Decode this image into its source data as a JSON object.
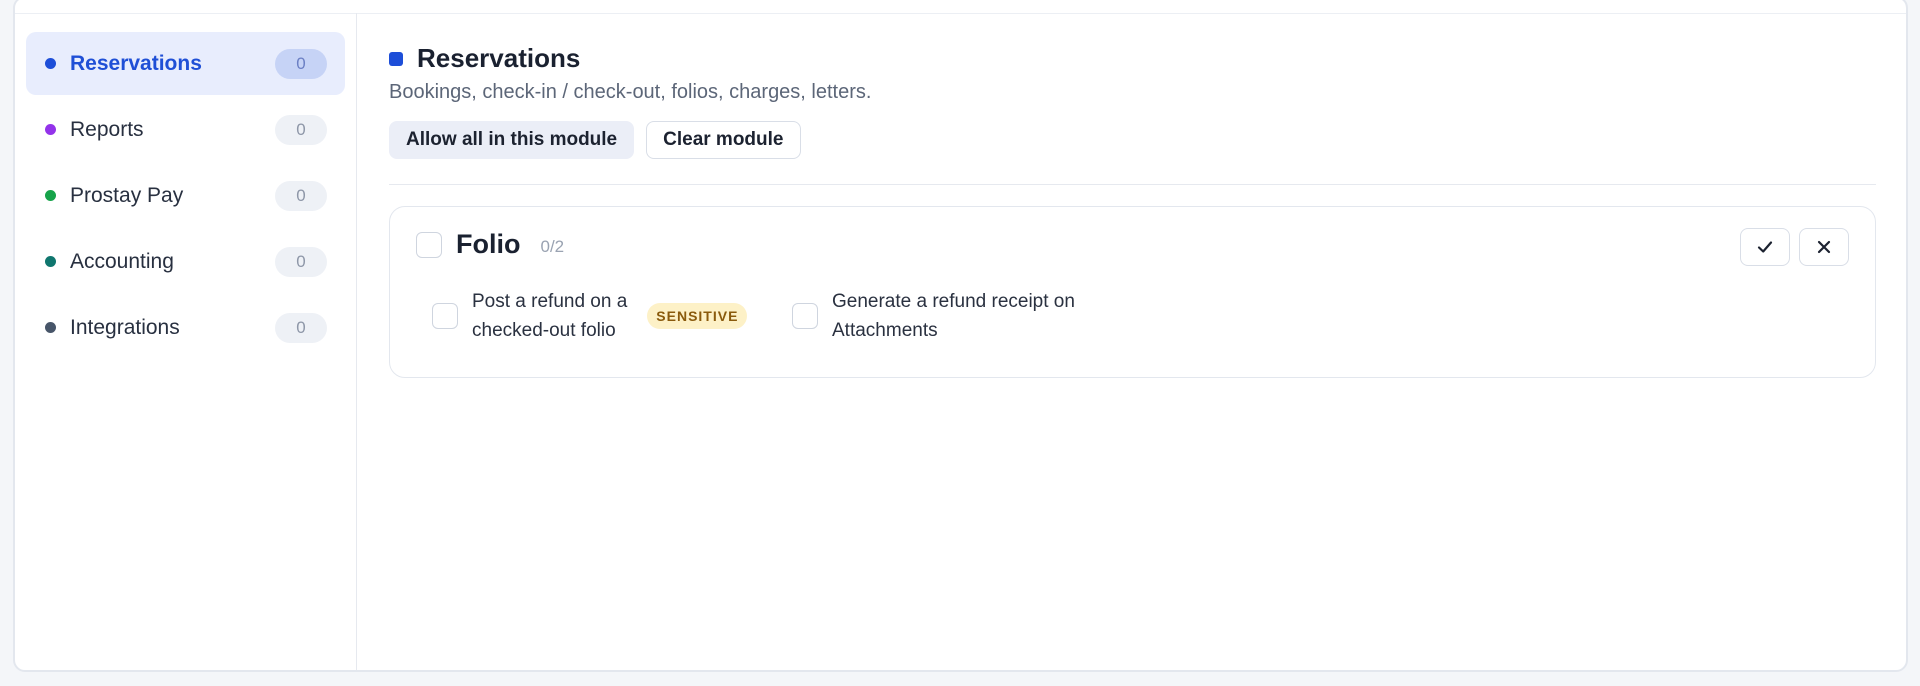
{
  "sidebar": {
    "items": [
      {
        "label": "Reservations",
        "count": "0",
        "color": "#1d4ed8",
        "active": true
      },
      {
        "label": "Reports",
        "count": "0",
        "color": "#9333ea",
        "active": false
      },
      {
        "label": "Prostay Pay",
        "count": "0",
        "color": "#16a34a",
        "active": false
      },
      {
        "label": "Accounting",
        "count": "0",
        "color": "#0f766e",
        "active": false
      },
      {
        "label": "Integrations",
        "count": "0",
        "color": "#475569",
        "active": false
      }
    ]
  },
  "module": {
    "title": "Reservations",
    "description": "Bookings, check-in / check-out, folios, charges, letters.",
    "color": "#1d4ed8",
    "allow_all_label": "Allow all in this module",
    "clear_label": "Clear module"
  },
  "group": {
    "title": "Folio",
    "count": "0/2",
    "permissions": [
      {
        "label_line1": "Post a refund on a",
        "label_line2": "checked-out folio",
        "badge": "SENSITIVE",
        "checked": false
      },
      {
        "label_line1": "Generate a refund receipt on",
        "label_line2": "Attachments",
        "checked": false
      }
    ]
  },
  "icons": {
    "allow_group": "check-icon",
    "clear_group": "close-icon"
  }
}
